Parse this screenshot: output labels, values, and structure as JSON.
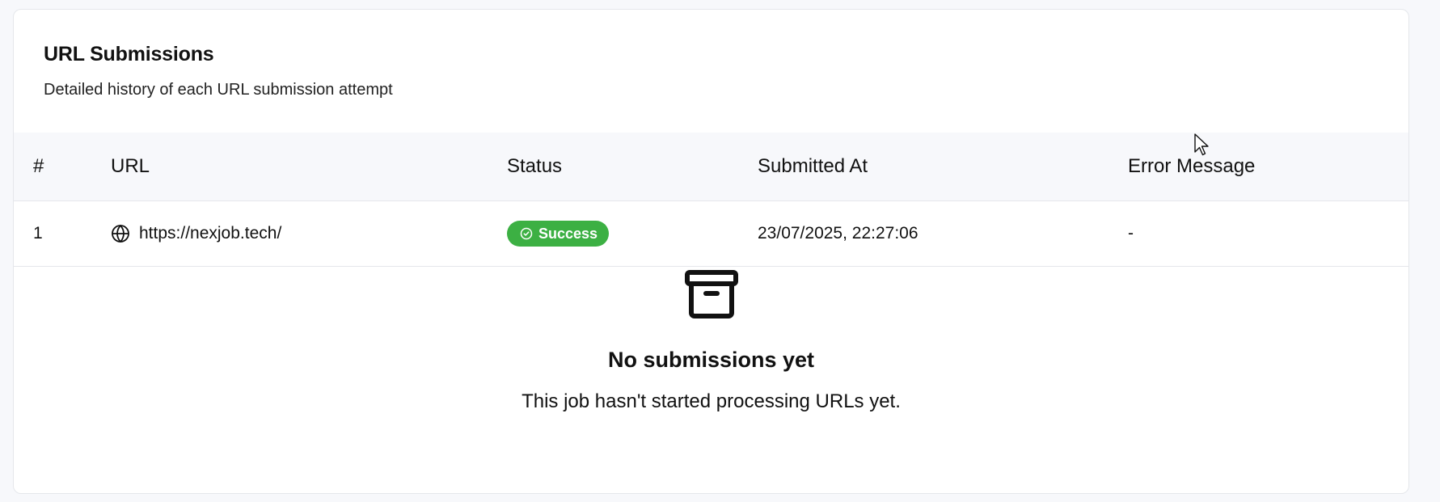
{
  "card": {
    "title": "URL Submissions",
    "subtitle": "Detailed history of each URL submission attempt"
  },
  "table": {
    "columns": [
      "#",
      "URL",
      "Status",
      "Submitted At",
      "Error Message"
    ],
    "rows": [
      {
        "index": "1",
        "url": "https://nexjob.tech/",
        "status": "Success",
        "submitted_at": "23/07/2025, 22:27:06",
        "error": "-"
      }
    ]
  },
  "empty_state": {
    "icon": "archive-icon",
    "title": "No submissions yet",
    "text": "This job hasn't started processing URLs yet."
  },
  "colors": {
    "success": "#3cb043",
    "header_bg": "#f7f8fb",
    "border": "#e5e7eb"
  }
}
